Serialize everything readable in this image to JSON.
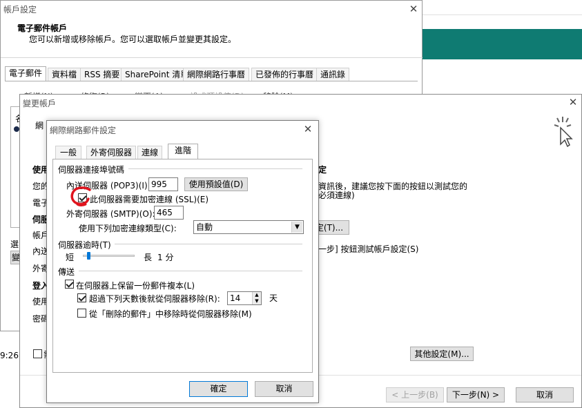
{
  "account_settings": {
    "title": "帳戶設定",
    "heading": "電子郵件帳戶",
    "subheading": "您可以新增或移除帳戶。您可以選取帳戶並變更其設定。",
    "tabs": [
      "電子郵件",
      "資料檔",
      "RSS 摘要",
      "SharePoint 清單",
      "網際網路行事曆",
      "已發佈的行事曆",
      "通訊錄"
    ],
    "toolbar": [
      "新增(N)...",
      "修復(R)...",
      "變更(A)...",
      "設成預設值(D)",
      "移除(M)"
    ],
    "list_header": "名",
    "left_labels": [
      "選",
      "變"
    ],
    "time_fragment": "9:26"
  },
  "change_account": {
    "title": "變更帳戶",
    "left_labels": [
      "網",
      "使用",
      "您的",
      "電子",
      "伺服",
      "帳戶",
      "內送",
      "外寄",
      "登入",
      "使用",
      "密碼"
    ],
    "right_heading": "定",
    "right_text_line1": "資訊後，建議您按下面的按鈕以測試您的",
    "right_text_line2": "必須連線)",
    "test_button_label": "定(T)...",
    "next_hint": "一步] 按鈕測試帳戶設定(S)",
    "remember_fragment": "需",
    "more_settings_label": "其他設定(M)...",
    "back_label": "< 上一步(B)",
    "next_label": "下一步(N) >",
    "cancel_label": "取消"
  },
  "internet_email": {
    "title": "網際網路郵件設定",
    "tabs": [
      "一般",
      "外寄伺服器",
      "連線",
      "進階"
    ],
    "active_tab": "進階",
    "ports_group": "伺服器連接埠號碼",
    "incoming_label": "內送伺服器 (POP3)(I):",
    "incoming_port": "995",
    "use_default_label": "使用預設值(D)",
    "ssl_label": "此伺服器需要加密連線 (SSL)(E)",
    "ssl_checked": true,
    "outgoing_label": "外寄伺服器 (SMTP)(O):",
    "outgoing_port": "465",
    "encryption_label": "使用下列加密連線類型(C):",
    "encryption_value": "自動",
    "timeout_group": "伺服器逾時(T)",
    "timeout_short": "短",
    "timeout_long": "長",
    "timeout_value": "1 分",
    "timeout_level": 0.08,
    "delivery_group": "傳送",
    "leave_copy_label": "在伺服器上保留一份郵件複本(L)",
    "leave_copy_checked": true,
    "remove_after_label": "超過下列天數後就從伺服器移除(R):",
    "remove_after_checked": true,
    "remove_days": "14",
    "days_unit": "天",
    "remove_deleted_label": "從「刪除的郵件」中移除時從伺服器移除(M)",
    "remove_deleted_checked": false,
    "ok_label": "確定",
    "cancel_label": "取消"
  },
  "colors": {
    "teal_band": "#0f7b72",
    "annotation": "#e0141e",
    "focus": "#0078d7"
  }
}
